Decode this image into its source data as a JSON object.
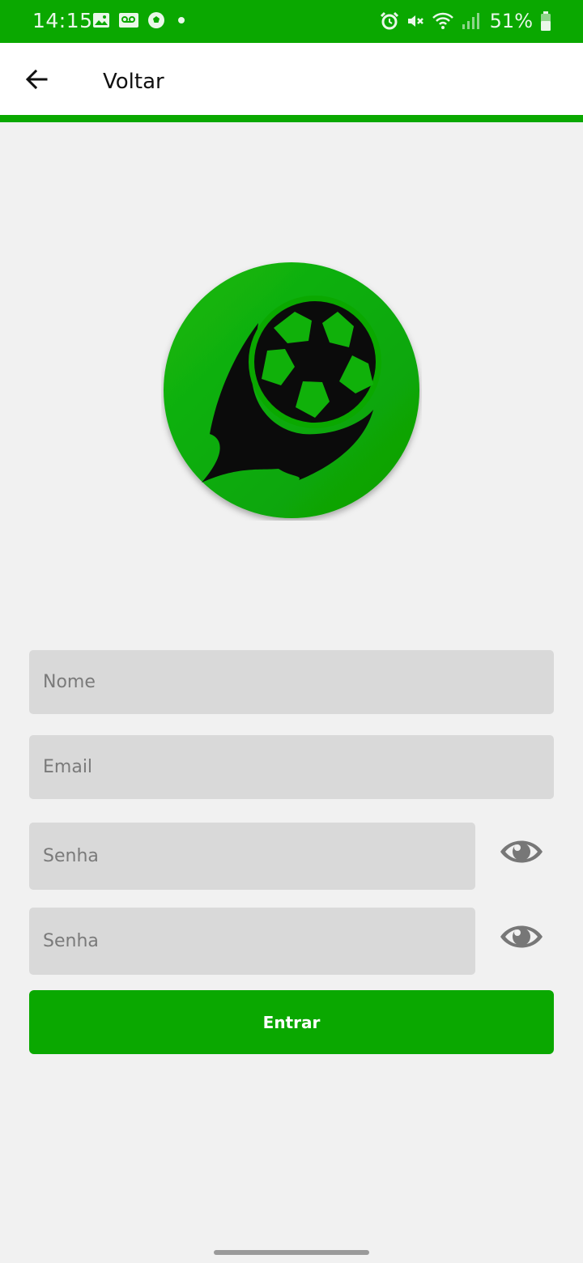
{
  "status_bar": {
    "time": "14:15",
    "battery": "51%",
    "left_icons": [
      "gallery-icon",
      "voicemail-icon",
      "soccer-ball-icon",
      "dot-icon"
    ],
    "right_icons": [
      "alarm-icon",
      "mute-icon",
      "wifi-icon",
      "signal-icon",
      "battery-icon"
    ]
  },
  "appbar": {
    "back_icon": "arrow-left-icon",
    "title": "Voltar"
  },
  "form": {
    "name_placeholder": "Nome",
    "email_placeholder": "Email",
    "password_placeholder": "Senha",
    "confirm_password_placeholder": "Senha",
    "eye_icon": "eye-icon",
    "submit_label": "Entrar"
  },
  "colors": {
    "brand_green": "#0aa800",
    "field_bg": "#d9d9d9",
    "page_bg": "#f1f1f1"
  }
}
